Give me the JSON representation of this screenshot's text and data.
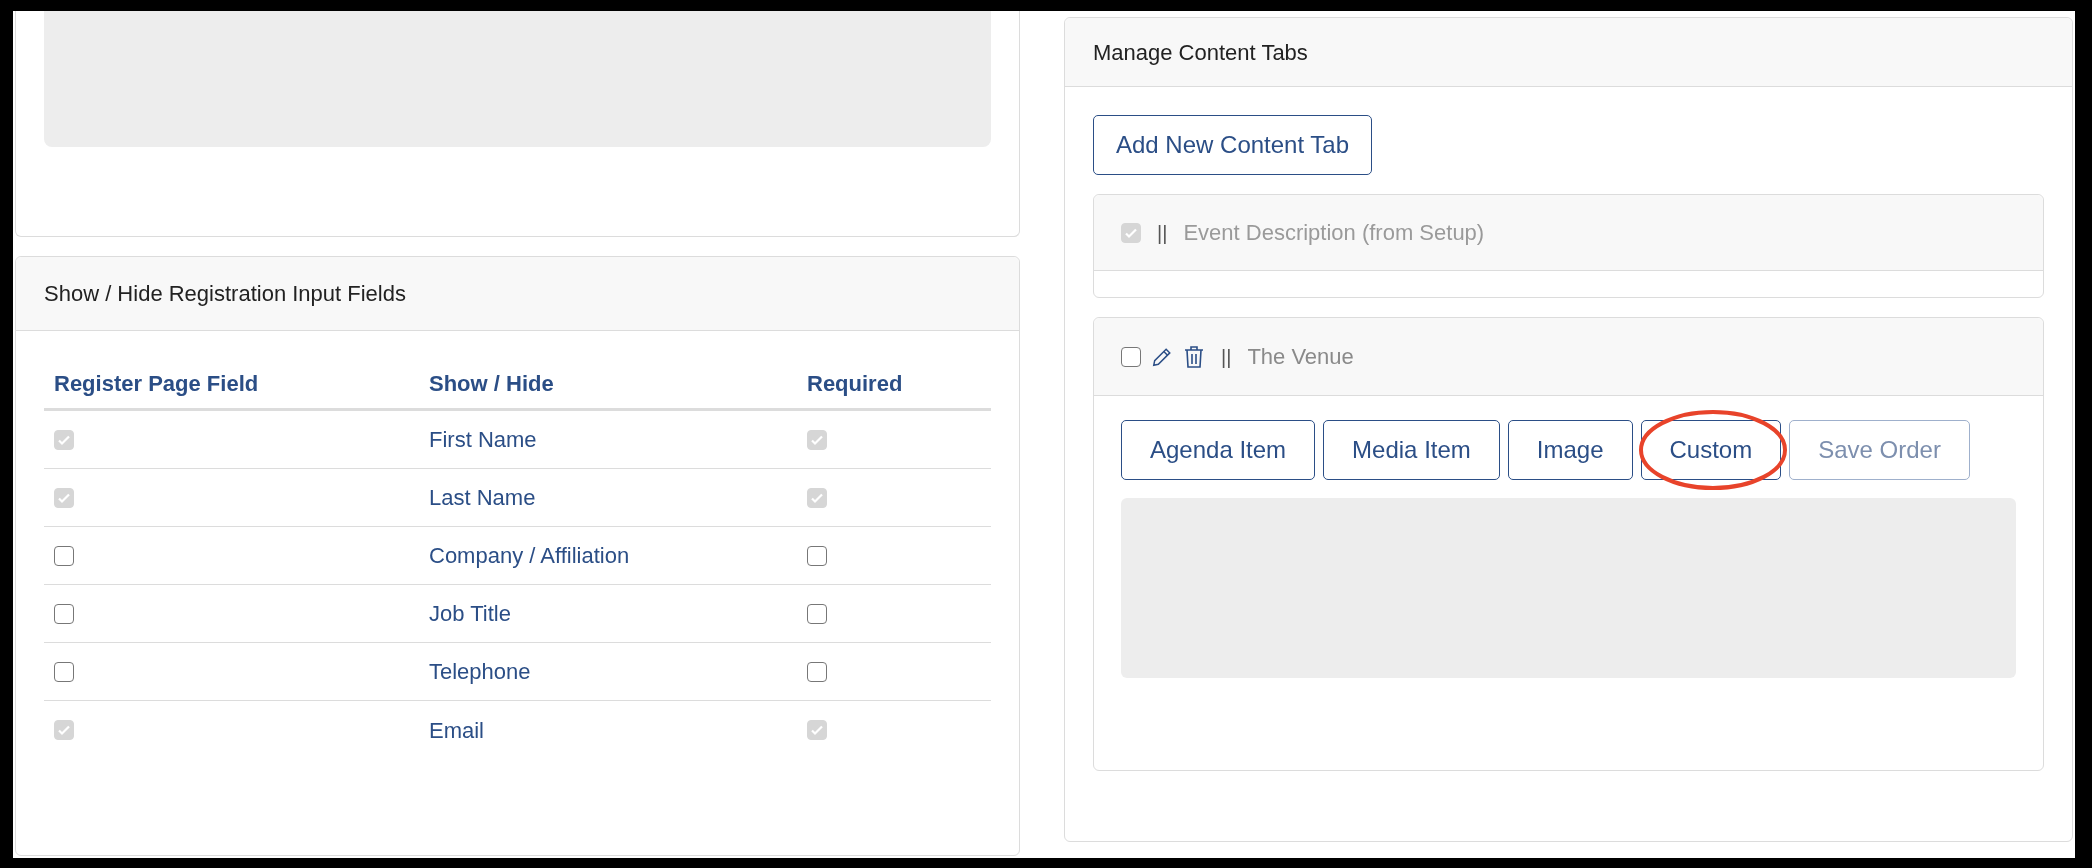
{
  "registration_fields": {
    "title": "Show / Hide Registration Input Fields",
    "columns": [
      "Register Page Field",
      "Show / Hide",
      "Required"
    ],
    "rows": [
      {
        "show": {
          "checked": true,
          "disabled": true
        },
        "label": "First Name",
        "required": {
          "checked": true,
          "disabled": true
        }
      },
      {
        "show": {
          "checked": true,
          "disabled": true
        },
        "label": "Last Name",
        "required": {
          "checked": true,
          "disabled": true
        }
      },
      {
        "show": {
          "checked": false,
          "disabled": false
        },
        "label": "Company / Affiliation",
        "required": {
          "checked": false,
          "disabled": false
        }
      },
      {
        "show": {
          "checked": false,
          "disabled": false
        },
        "label": "Job Title",
        "required": {
          "checked": false,
          "disabled": false
        }
      },
      {
        "show": {
          "checked": false,
          "disabled": false
        },
        "label": "Telephone",
        "required": {
          "checked": false,
          "disabled": false
        }
      },
      {
        "show": {
          "checked": true,
          "disabled": true
        },
        "label": "Email",
        "required": {
          "checked": true,
          "disabled": true
        }
      }
    ]
  },
  "content_tabs": {
    "title": "Manage Content Tabs",
    "add_button": "Add New Content Tab",
    "tabs": [
      {
        "title": "Event Description (from Setup)",
        "checked": true,
        "disabled": true,
        "editable": false,
        "drag_handle": "||"
      },
      {
        "title": "The Venue",
        "checked": false,
        "disabled": false,
        "editable": true,
        "drag_handle": "||",
        "buttons": [
          {
            "label": "Agenda Item",
            "disabled": false,
            "highlighted": false
          },
          {
            "label": "Media Item",
            "disabled": false,
            "highlighted": false
          },
          {
            "label": "Image",
            "disabled": false,
            "highlighted": false
          },
          {
            "label": "Custom",
            "disabled": false,
            "highlighted": true
          },
          {
            "label": "Save Order",
            "disabled": true,
            "highlighted": false
          }
        ]
      }
    ]
  }
}
